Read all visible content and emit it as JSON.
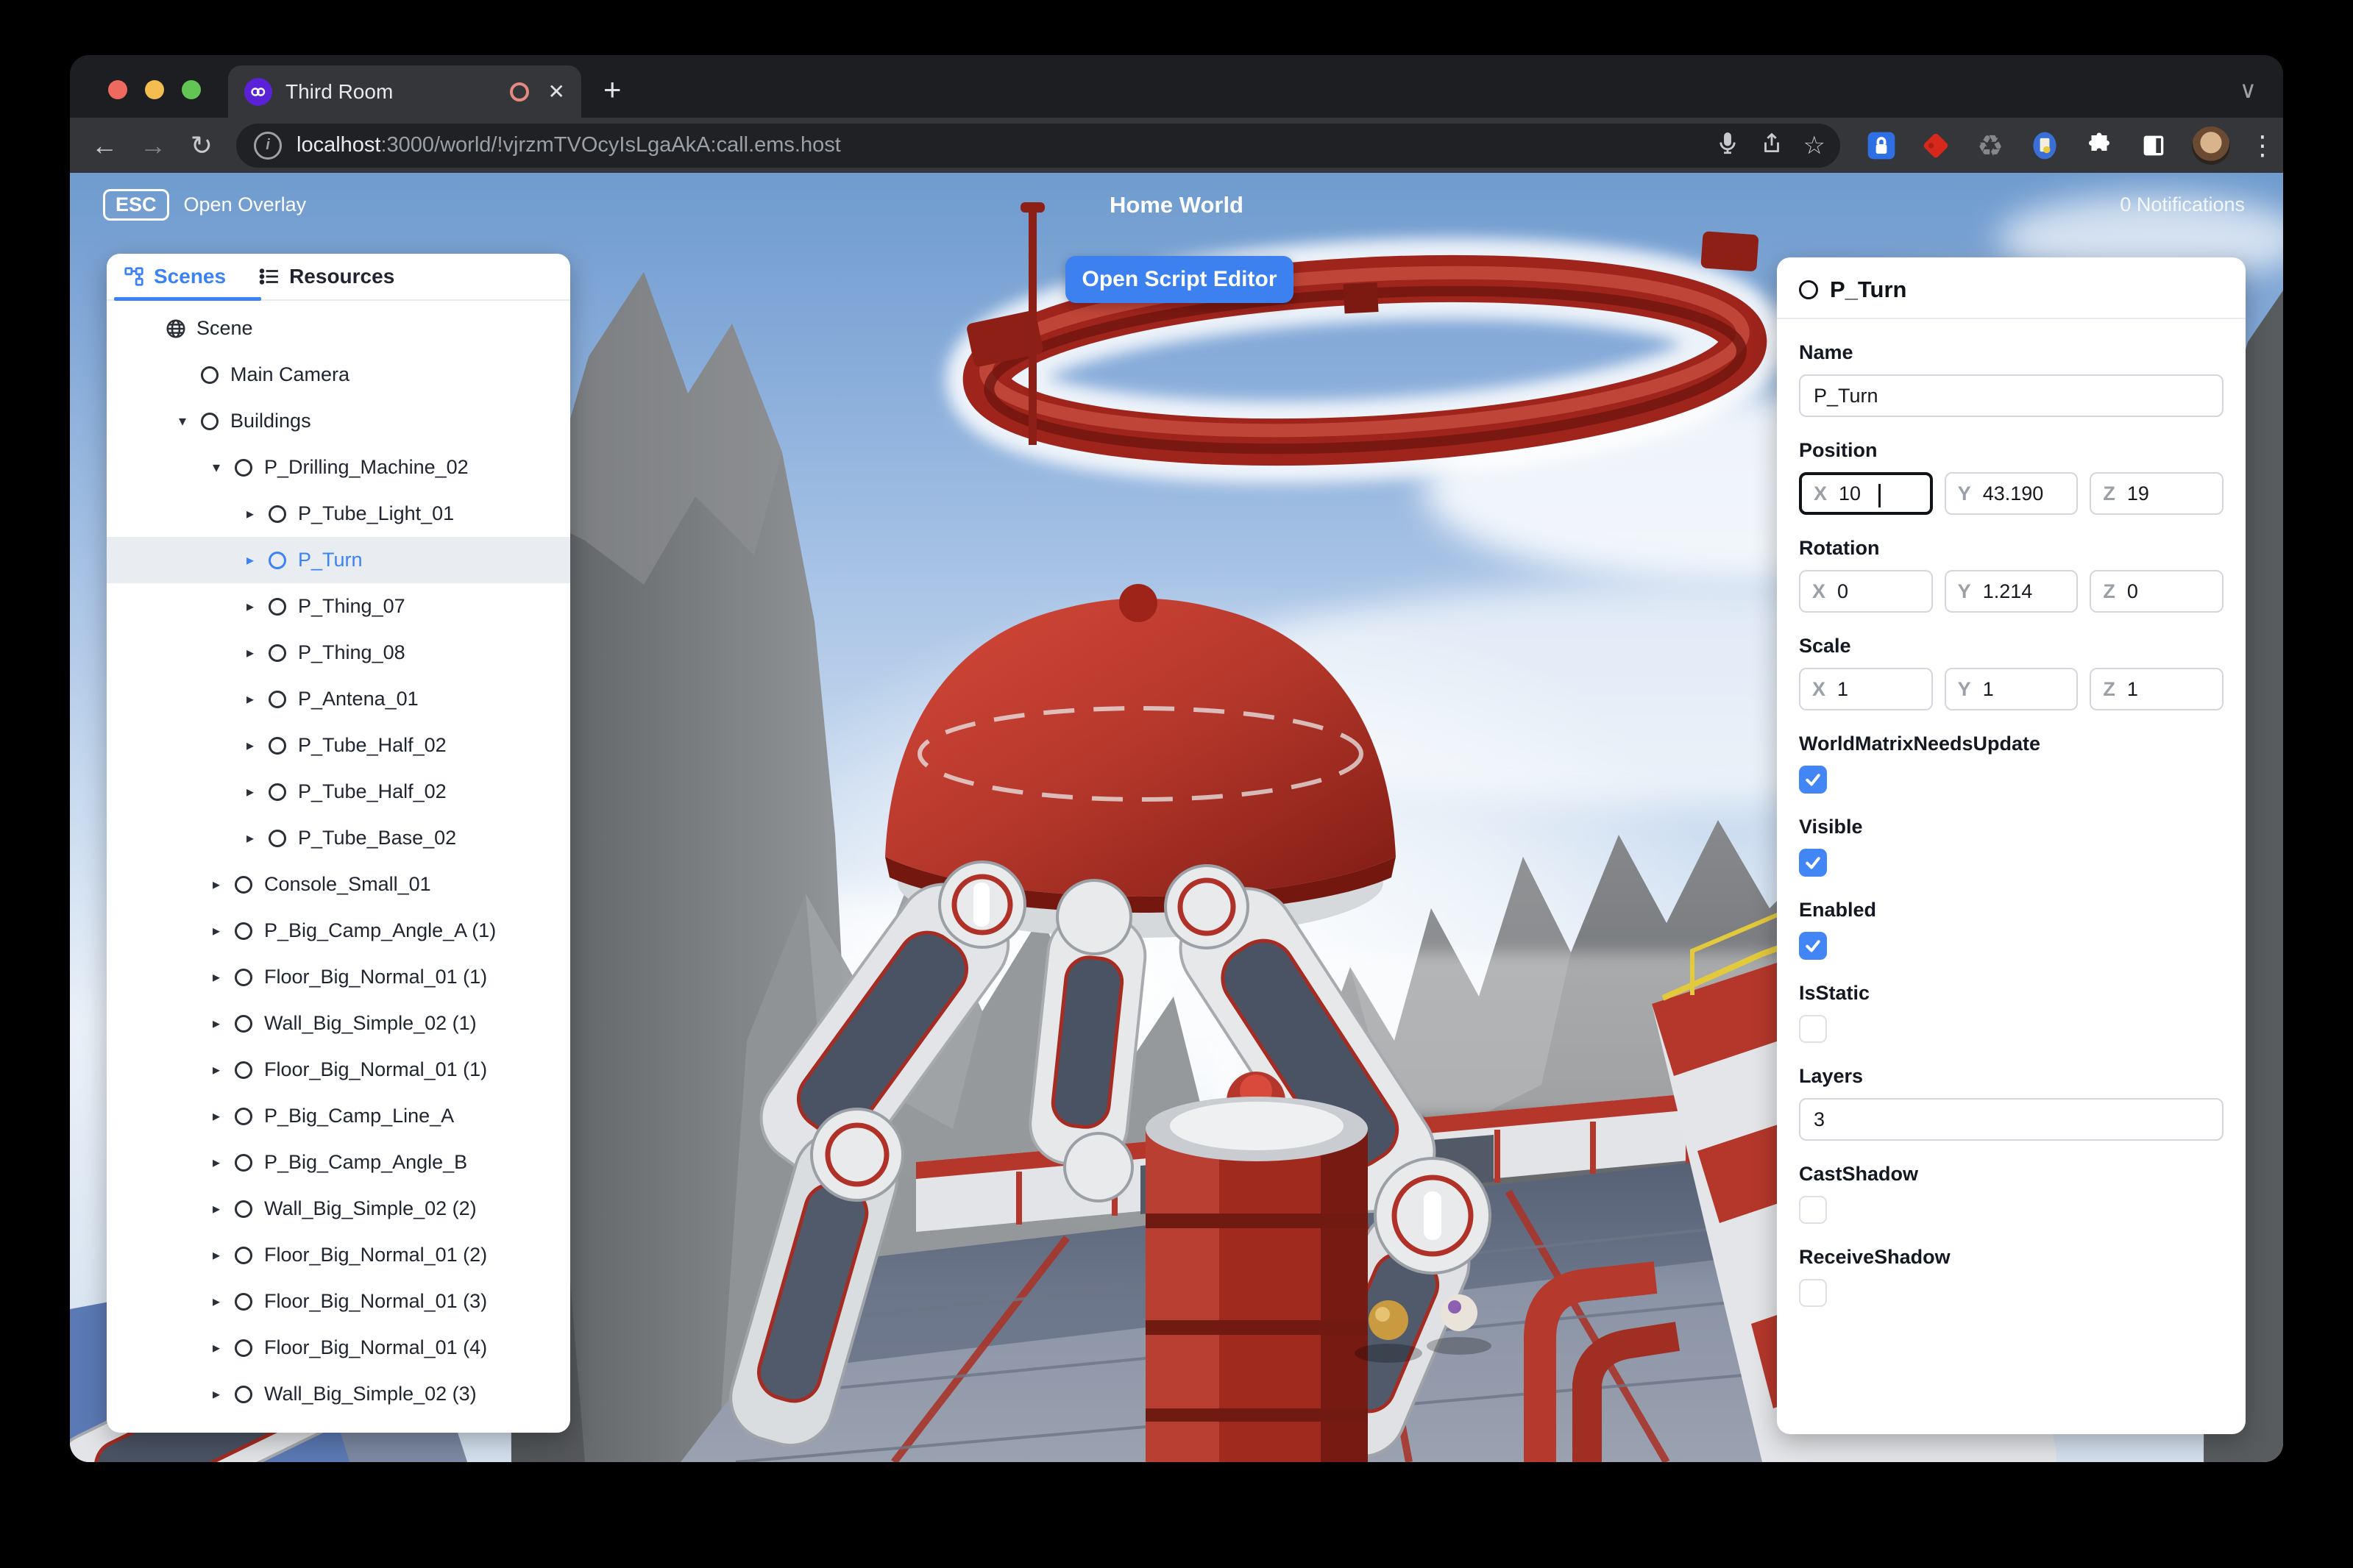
{
  "browser": {
    "tab": {
      "title": "Third Room"
    },
    "url": {
      "host": "localhost",
      "rest": ":3000/world/!vjrzmTVOcyIsLgaAkA:call.ems.host"
    }
  },
  "icons": {
    "back": "←",
    "forward": "→",
    "reload": "↻",
    "star": "☆",
    "plus": "+",
    "close": "✕",
    "menu": "⋮",
    "recycle": "♻",
    "chevron_down": "∨",
    "info": "i",
    "caret_down": "▾",
    "caret_right": "▸"
  },
  "hud": {
    "esc_key": "ESC",
    "open_overlay": "Open Overlay",
    "world_title": "Home World",
    "notifications": "0 Notifications",
    "open_script_editor": "Open Script Editor"
  },
  "left_panel": {
    "tabs": [
      {
        "label": "Scenes",
        "active": true
      },
      {
        "label": "Resources",
        "active": false
      }
    ],
    "tree": [
      {
        "label": "Scene",
        "depth": 0,
        "icon": "globe",
        "caret": "",
        "selected": false
      },
      {
        "label": "Main Camera",
        "depth": 1,
        "icon": "entity",
        "caret": "",
        "selected": false
      },
      {
        "label": "Buildings",
        "depth": 1,
        "icon": "entity",
        "caret": "down",
        "selected": false
      },
      {
        "label": "P_Drilling_Machine_02",
        "depth": 2,
        "icon": "entity",
        "caret": "down",
        "selected": false
      },
      {
        "label": "P_Tube_Light_01",
        "depth": 3,
        "icon": "entity",
        "caret": "right",
        "selected": false
      },
      {
        "label": "P_Turn",
        "depth": 3,
        "icon": "entity",
        "caret": "right",
        "selected": true
      },
      {
        "label": "P_Thing_07",
        "depth": 3,
        "icon": "entity",
        "caret": "right",
        "selected": false
      },
      {
        "label": "P_Thing_08",
        "depth": 3,
        "icon": "entity",
        "caret": "right",
        "selected": false
      },
      {
        "label": "P_Antena_01",
        "depth": 3,
        "icon": "entity",
        "caret": "right",
        "selected": false
      },
      {
        "label": "P_Tube_Half_02",
        "depth": 3,
        "icon": "entity",
        "caret": "right",
        "selected": false
      },
      {
        "label": "P_Tube_Half_02",
        "depth": 3,
        "icon": "entity",
        "caret": "right",
        "selected": false
      },
      {
        "label": "P_Tube_Base_02",
        "depth": 3,
        "icon": "entity",
        "caret": "right",
        "selected": false
      },
      {
        "label": "Console_Small_01",
        "depth": 2,
        "icon": "entity",
        "caret": "right",
        "selected": false
      },
      {
        "label": "P_Big_Camp_Angle_A (1)",
        "depth": 2,
        "icon": "entity",
        "caret": "right",
        "selected": false
      },
      {
        "label": "Floor_Big_Normal_01 (1)",
        "depth": 2,
        "icon": "entity",
        "caret": "right",
        "selected": false
      },
      {
        "label": "Wall_Big_Simple_02 (1)",
        "depth": 2,
        "icon": "entity",
        "caret": "right",
        "selected": false
      },
      {
        "label": "Floor_Big_Normal_01 (1)",
        "depth": 2,
        "icon": "entity",
        "caret": "right",
        "selected": false
      },
      {
        "label": "P_Big_Camp_Line_A",
        "depth": 2,
        "icon": "entity",
        "caret": "right",
        "selected": false
      },
      {
        "label": "P_Big_Camp_Angle_B",
        "depth": 2,
        "icon": "entity",
        "caret": "right",
        "selected": false
      },
      {
        "label": "Wall_Big_Simple_02 (2)",
        "depth": 2,
        "icon": "entity",
        "caret": "right",
        "selected": false
      },
      {
        "label": "Floor_Big_Normal_01 (2)",
        "depth": 2,
        "icon": "entity",
        "caret": "right",
        "selected": false
      },
      {
        "label": "Floor_Big_Normal_01 (3)",
        "depth": 2,
        "icon": "entity",
        "caret": "right",
        "selected": false
      },
      {
        "label": "Floor_Big_Normal_01 (4)",
        "depth": 2,
        "icon": "entity",
        "caret": "right",
        "selected": false
      },
      {
        "label": "Wall_Big_Simple_02 (3)",
        "depth": 2,
        "icon": "entity",
        "caret": "right",
        "selected": false
      }
    ]
  },
  "inspector": {
    "title": "P_Turn",
    "axes": [
      "X",
      "Y",
      "Z"
    ],
    "name": {
      "label": "Name",
      "value": "P_Turn"
    },
    "position": {
      "label": "Position",
      "x": "10",
      "y": "43.190",
      "z": "19"
    },
    "rotation": {
      "label": "Rotation",
      "x": "0",
      "y": "1.214",
      "z": "0"
    },
    "scale": {
      "label": "Scale",
      "x": "1",
      "y": "1",
      "z": "1"
    },
    "toggles": [
      {
        "label": "WorldMatrixNeedsUpdate",
        "checked": true
      },
      {
        "label": "Visible",
        "checked": true
      },
      {
        "label": "Enabled",
        "checked": true
      },
      {
        "label": "IsStatic",
        "checked": false
      }
    ],
    "layers": {
      "label": "Layers",
      "value": "3"
    },
    "shadow_toggles": [
      {
        "label": "CastShadow",
        "checked": false
      },
      {
        "label": "ReceiveShadow",
        "checked": false
      }
    ]
  },
  "colors": {
    "accent_blue": "#3b82f6",
    "checkbox_blue": "#4285f4",
    "machine_red": "#b5372b",
    "chrome_dark": "#202124",
    "chrome_mid": "#35363a",
    "traffic_red": "#ee6a5f",
    "traffic_yellow": "#f5bd4f",
    "traffic_green": "#62c554"
  }
}
